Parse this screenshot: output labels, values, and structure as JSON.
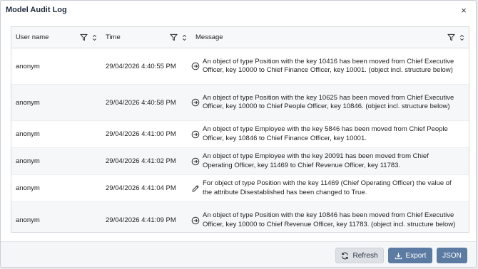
{
  "dialog": {
    "title": "Model Audit Log",
    "close_symbol": "×"
  },
  "columns": {
    "user": "User name",
    "time": "Time",
    "message": "Message"
  },
  "rows": [
    {
      "user": "anonym",
      "time": "29/04/2026 4:40:55 PM",
      "icon": "move-icon",
      "message": "An object of type Position with the key 10416 has been moved from Chief Executive Officer, key 10000 to Chief Finance Officer, key 10001. (object incl. structure below)"
    },
    {
      "user": "anonym",
      "time": "29/04/2026 4:40:58 PM",
      "icon": "move-icon",
      "message": "An object of type Position with the key 10625 has been moved from Chief Executive Officer, key 10000 to Chief People Officer, key 10846. (object incl. structure below)"
    },
    {
      "user": "anonym",
      "time": "29/04/2026 4:41:00 PM",
      "icon": "move-icon",
      "message": "An object of type Employee with the key 5846 has been moved from Chief People Officer, key 10846 to Chief Finance Officer, key 10001."
    },
    {
      "user": "anonym",
      "time": "29/04/2026 4:41:02 PM",
      "icon": "move-icon",
      "message": "An object of type Employee with the key 20091 has been moved from Chief Operating Officer, key 11469 to Chief Revenue Officer, key 11783."
    },
    {
      "user": "anonym",
      "time": "29/04/2026 4:41:04 PM",
      "icon": "edit-icon",
      "message": "For object of type Position with the key 11469 (Chief Operating Officer) the value of the attribute Disestablished has been changed to True."
    },
    {
      "user": "anonym",
      "time": "29/04/2026 4:41:09 PM",
      "icon": "move-icon",
      "message": "An object of type Position with the key 10846 has been moved from Chief Executive Officer, key 10000 to Chief Revenue Officer, key 11783. (object incl. structure below)"
    }
  ],
  "footer": {
    "refresh_label": "Refresh",
    "export_label": "Export",
    "json_label": "JSON"
  },
  "colors": {
    "primary_button": "#5b7ba3",
    "secondary_button": "#dde1e6"
  }
}
